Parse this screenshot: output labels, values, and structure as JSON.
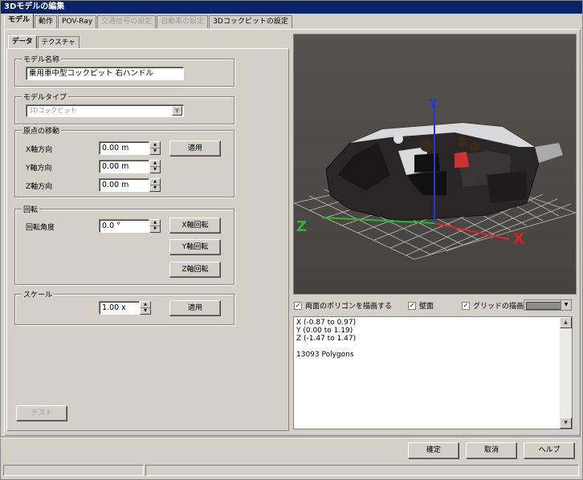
{
  "window": {
    "title": "3Dモデルの編集"
  },
  "tabs": [
    {
      "label": "モデル",
      "state": "active"
    },
    {
      "label": "動作",
      "state": "normal"
    },
    {
      "label": "POV-Ray",
      "state": "normal"
    },
    {
      "label": "交通信号の設定",
      "state": "disabled"
    },
    {
      "label": "自動車の設定",
      "state": "disabled"
    },
    {
      "label": "3Dコックピットの設定",
      "state": "normal"
    }
  ],
  "subtabs": [
    {
      "label": "データ",
      "state": "active"
    },
    {
      "label": "テクスチャ",
      "state": "normal"
    }
  ],
  "model_name": {
    "label": "モデル名称",
    "value": "乗用車中型コックピット 右ハンドル"
  },
  "model_type": {
    "label": "モデルタイプ",
    "value": "3Dコックピット"
  },
  "origin": {
    "label": "原点の移動",
    "x_label": "X軸方向",
    "x_value": "0.00 m",
    "y_label": "Y軸方向",
    "y_value": "0.00 m",
    "z_label": "Z軸方向",
    "z_value": "0.00 m",
    "apply_label": "適用"
  },
  "rotation": {
    "label": "回転",
    "angle_label": "回転角度",
    "angle_value": "0.0 °",
    "x_button": "X軸回転",
    "y_button": "Y軸回転",
    "z_button": "Z軸回転"
  },
  "scale": {
    "label": "スケール",
    "value": "1.00 x",
    "apply_label": "適用"
  },
  "test_button": "テスト",
  "viewport": {
    "axis_x": "X",
    "axis_y": "Y",
    "axis_z": "Z",
    "axis_x_color": "#e02020",
    "axis_y_color": "#1a3fd0",
    "axis_z_color": "#2fb82f"
  },
  "options": {
    "draw_backfaces": {
      "label": "両面のポリゴンを描画する",
      "checked": true
    },
    "walls": {
      "label": "壁面",
      "checked": true
    },
    "draw_grid": {
      "label": "グリッドの描画",
      "checked": true
    },
    "grid_color": "#8c8c8c"
  },
  "info": {
    "x_range": "X (-0.87 to 0.97)",
    "y_range": "Y (0.00 to 1.19)",
    "z_range": "Z (-1.47 to 1.47)",
    "polygons": "13093 Polygons"
  },
  "footer": {
    "ok": "確定",
    "cancel": "取消",
    "help": "ヘルプ"
  }
}
